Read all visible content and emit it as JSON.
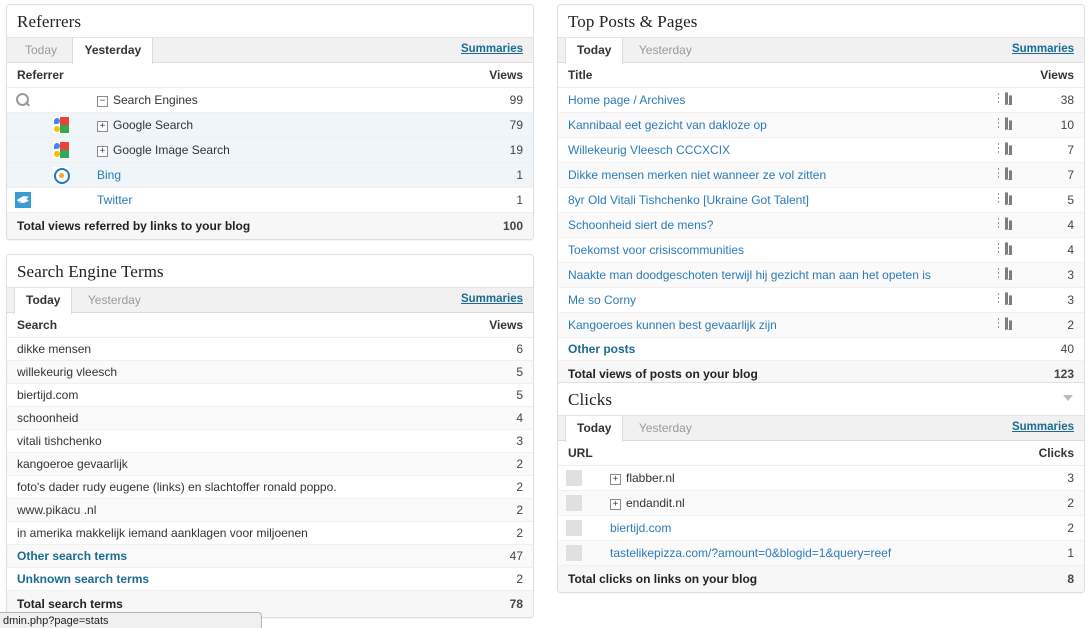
{
  "panels": {
    "referrers": {
      "title": "Referrers",
      "tabs": [
        {
          "label": "Today",
          "active": false
        },
        {
          "label": "Yesterday",
          "active": true
        }
      ],
      "summaries_label": "Summaries",
      "columns": {
        "name": "Referrer",
        "value": "Views"
      },
      "rows": [
        {
          "label": "Search Engines",
          "views": "99",
          "icon": "search-icon",
          "expander": "minus",
          "link": false,
          "level": 0
        },
        {
          "label": "Google Search",
          "views": "79",
          "icon": "google-favicon",
          "expander": "plus",
          "link": false,
          "level": 1
        },
        {
          "label": "Google Image Search",
          "views": "19",
          "icon": "google-favicon",
          "expander": "plus",
          "link": false,
          "level": 1
        },
        {
          "label": "Bing",
          "views": "1",
          "icon": "bing-favicon",
          "expander": "none",
          "link": true,
          "level": 1
        },
        {
          "label": "Twitter",
          "views": "1",
          "icon": "twitter-favicon",
          "expander": "none",
          "link": true,
          "level": 0
        }
      ],
      "total": {
        "label": "Total views referred by links to your blog",
        "value": "100"
      }
    },
    "search_terms": {
      "title": "Search Engine Terms",
      "tabs": [
        {
          "label": "Today",
          "active": true
        },
        {
          "label": "Yesterday",
          "active": false
        }
      ],
      "summaries_label": "Summaries",
      "columns": {
        "name": "Search",
        "value": "Views"
      },
      "rows": [
        {
          "label": "dikke mensen",
          "views": "6",
          "link": false
        },
        {
          "label": "willekeurig vleesch",
          "views": "5",
          "link": false
        },
        {
          "label": "biertijd.com",
          "views": "5",
          "link": false
        },
        {
          "label": "schoonheid",
          "views": "4",
          "link": false
        },
        {
          "label": "vitali tishchenko",
          "views": "3",
          "link": false
        },
        {
          "label": "kangoeroe gevaarlijk",
          "views": "2",
          "link": false
        },
        {
          "label": "foto's dader rudy eugene (links) en slachtoffer ronald poppo.",
          "views": "2",
          "link": false
        },
        {
          "label": "www.pikacu .nl",
          "views": "2",
          "link": false
        },
        {
          "label": "in amerika makkelijk iemand aanklagen voor miljoenen",
          "views": "2",
          "link": false
        },
        {
          "label": "Other search terms",
          "views": "47",
          "link": true
        },
        {
          "label": "Unknown search terms",
          "views": "2",
          "link": true
        }
      ],
      "total": {
        "label": "Total search terms",
        "value": "78"
      }
    },
    "top_posts": {
      "title": "Top Posts & Pages",
      "tabs": [
        {
          "label": "Today",
          "active": true
        },
        {
          "label": "Yesterday",
          "active": false
        }
      ],
      "summaries_label": "Summaries",
      "columns": {
        "name": "Title",
        "value": "Views"
      },
      "rows": [
        {
          "label": "Home page / Archives",
          "views": "38",
          "link": true,
          "chart": true
        },
        {
          "label": "Kannibaal eet gezicht van dakloze op",
          "views": "10",
          "link": true,
          "chart": true
        },
        {
          "label": "Willekeurig Vleesch CCCXCIX",
          "views": "7",
          "link": true,
          "chart": true
        },
        {
          "label": "Dikke mensen merken niet wanneer ze vol zitten",
          "views": "7",
          "link": true,
          "chart": true
        },
        {
          "label": "8yr Old Vitali Tishchenko [Ukraine Got Talent]",
          "views": "5",
          "link": true,
          "chart": true
        },
        {
          "label": "Schoonheid siert de mens?",
          "views": "4",
          "link": true,
          "chart": true
        },
        {
          "label": "Toekomst voor crisiscommunities",
          "views": "4",
          "link": true,
          "chart": true
        },
        {
          "label": "Naakte man doodgeschoten terwijl hij gezicht man aan het opeten is",
          "views": "3",
          "link": true,
          "chart": true
        },
        {
          "label": "Me so Corny",
          "views": "3",
          "link": true,
          "chart": true
        },
        {
          "label": "Kangoeroes kunnen best gevaarlijk zijn",
          "views": "2",
          "link": true,
          "chart": true
        },
        {
          "label": "Other posts",
          "views": "40",
          "link": true,
          "bold": true,
          "chart": false
        }
      ],
      "total": {
        "label": "Total views of posts on your blog",
        "value": "123"
      }
    },
    "clicks": {
      "title": "Clicks",
      "collapse_icon": "chevron-down-icon",
      "tabs": [
        {
          "label": "Today",
          "active": true
        },
        {
          "label": "Yesterday",
          "active": false
        }
      ],
      "summaries_label": "Summaries",
      "columns": {
        "name": "URL",
        "value": "Clicks"
      },
      "rows": [
        {
          "label": "flabber.nl",
          "clicks": "3",
          "expander": "plus",
          "link": false
        },
        {
          "label": "endandit.nl",
          "clicks": "2",
          "expander": "plus",
          "link": false
        },
        {
          "label": "biertijd.com",
          "clicks": "2",
          "expander": "none",
          "link": true
        },
        {
          "label": "tastelikepizza.com/?amount=0&blogid=1&query=reef",
          "clicks": "1",
          "expander": "none",
          "link": true
        }
      ],
      "total": {
        "label": "Total clicks on links on your blog",
        "value": "8"
      }
    }
  },
  "status_bar": {
    "url": "dmin.php?page=stats"
  },
  "colors": {
    "link": "#2b7bb9",
    "link_bold": "#1b6a94",
    "child_row": "#eff5f9",
    "panel_border": "#dfdfdf"
  }
}
